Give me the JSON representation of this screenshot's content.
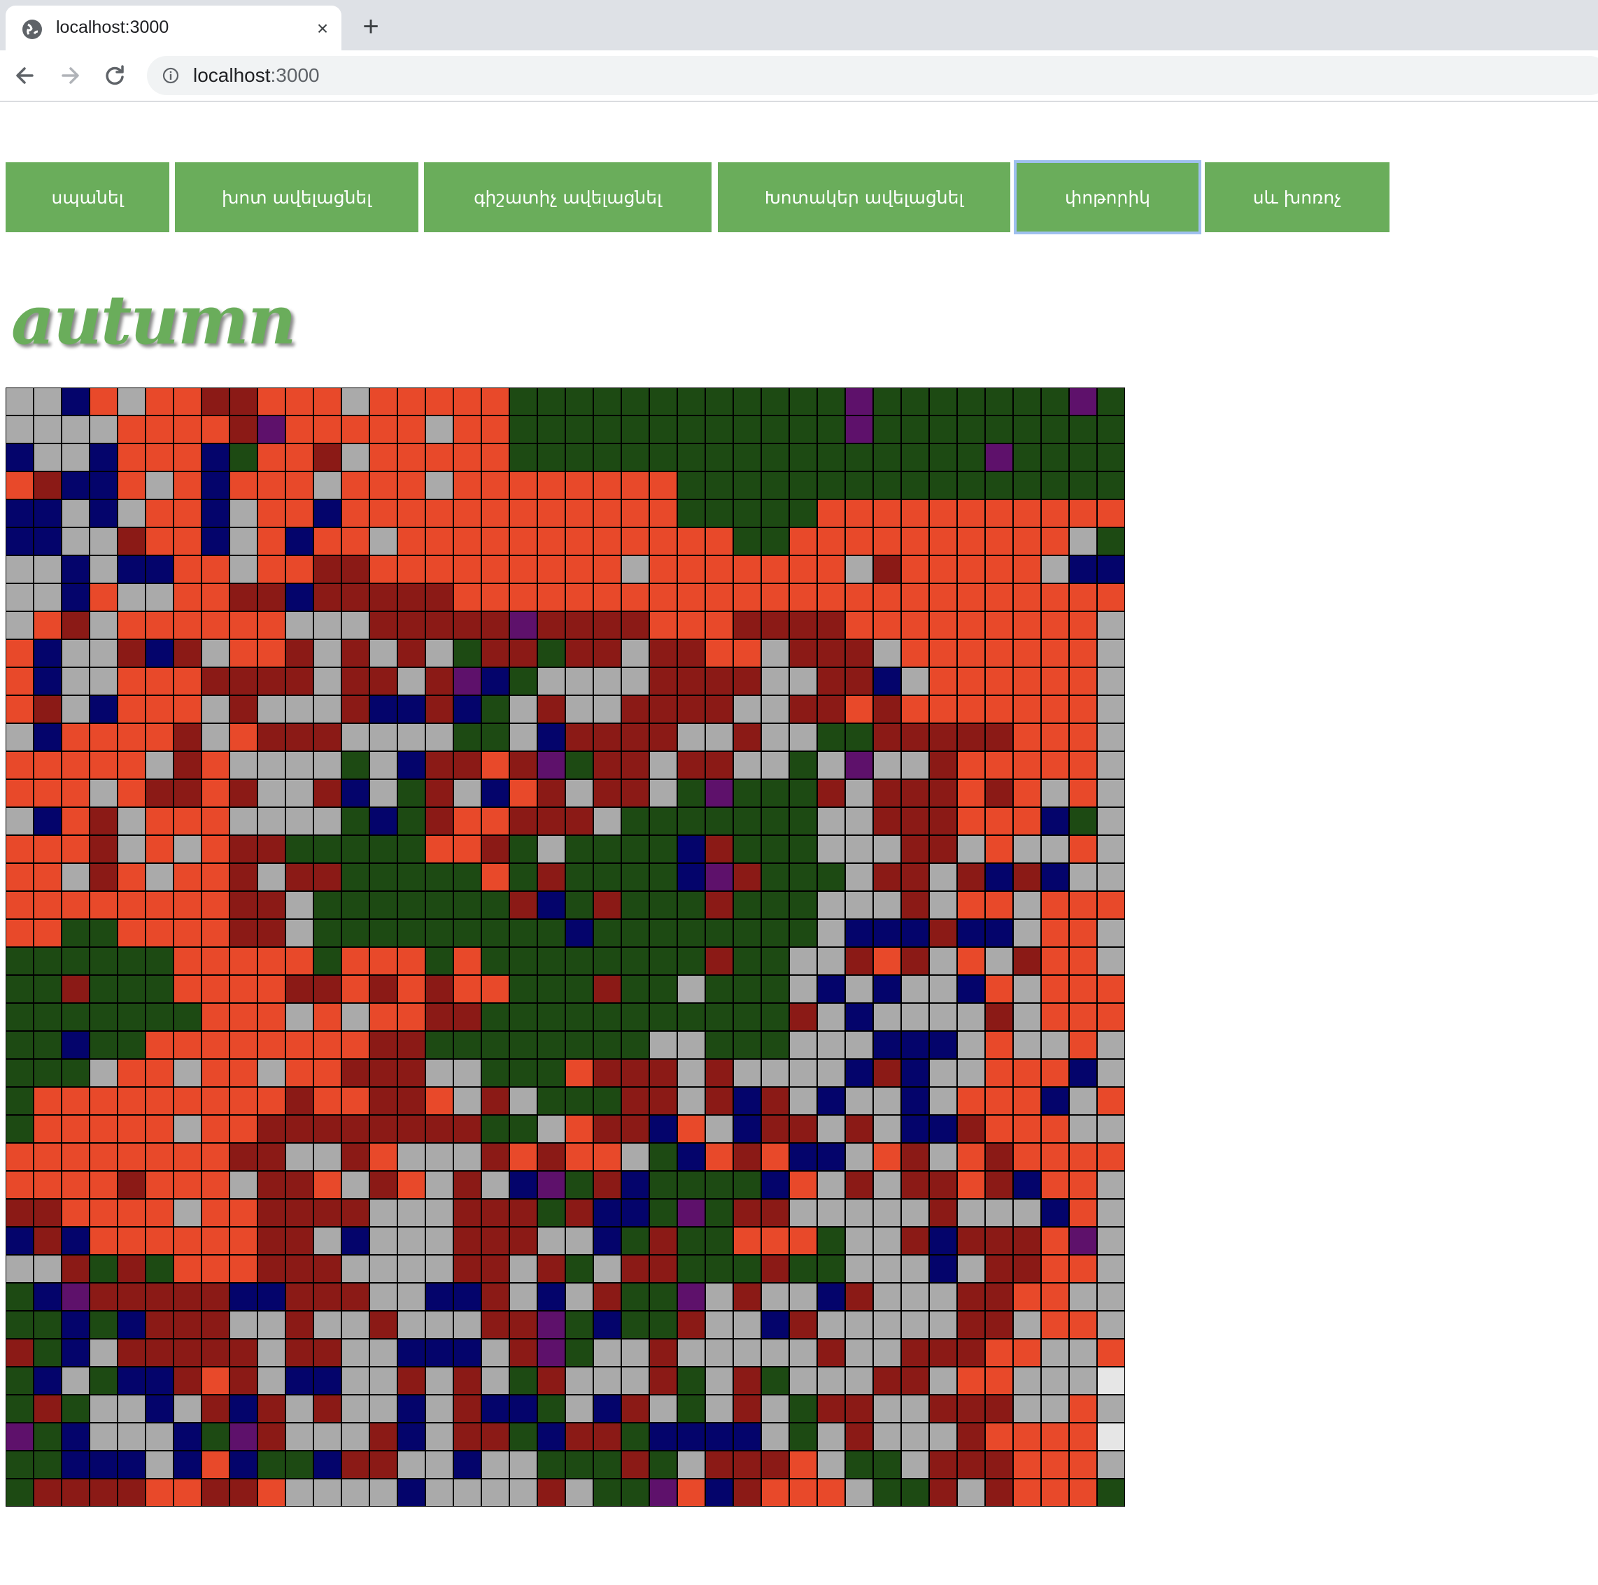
{
  "browser": {
    "tab_title": "localhost:3000",
    "close_symbol": "×",
    "new_tab_symbol": "+",
    "url_host": "localhost",
    "url_port": ":3000",
    "icons": [
      "globe-icon",
      "close-icon",
      "plus-icon",
      "back-icon",
      "forward-icon",
      "reload-icon",
      "info-icon"
    ]
  },
  "buttons": [
    {
      "label": "սպանել"
    },
    {
      "label": "խոտ ավելացնել"
    },
    {
      "label": "գիշատիչ ավելացնել"
    },
    {
      "label": "Խոտակեր ավելացնել"
    },
    {
      "label": "փոթորիկ"
    },
    {
      "label": "սև խոռոչ"
    }
  ],
  "season": "autumn",
  "colors": {
    "accent": "#6aad5b",
    "palette": {
      "O": "#e8492a",
      "R": "#8b1a16",
      "G": "#aaaaaa",
      "D": "#1d4a13",
      "N": "#04046b",
      "P": "#5e116b",
      "W": "#e6e6e6"
    }
  },
  "grid": {
    "columns": 40,
    "rows": [
      "GGNOGOORROOOGOOOOODDDDDDDDDDDDPDDDDDDDPDD",
      "GGGGOOOORPOOOOOGOODDDDDDDDDDDDPDDDDDDDDDG",
      "NGGNOOONDOORGOOOOODDDDDDDDDDDDDDDDDPDDDDG",
      "ORNNOGONOOOGOOOGOOOOOOOODDDDDDDDDDDDDDDDG",
      "NNGNGOONGOONOOOOOOOOOOOODDDDDOOOOOOOOOOOG",
      "NNGGROONGONOOGOOOOOOOOOOOODDOOOOOOOOOOGD",
      "GGNGNNOOGOORROOOOOOOOOGOOOOOOOGROOOOOGNN",
      "GGNOGGOORRNRRRRROOOOOOOOOOOOOOOOOOOOOOOO",
      "GORGOOOOOOGGGRRRRRPRRRROOORRRROOOOOOOOOG",
      "ONGGRNRGOORGRGRGDRRDRRGRROOGRRRGOOOOOOOG",
      "ONGGOOORRRRGRRGRPNDGGGGRRRRGGRRNGOOOOOOG",
      "ORGNOOOGRGGGRNNRNDGRGGRRRRGGRROROOOOOOOG",
      "GNOOOORGORRRGGGGDDGNRRRRGGRGGDDRRRRROOOG",
      "OOOOOGROGGGGDGNRRORPDRRGRRGGDGPGGROOOOOG",
      "OOOGORRORGGRNGDRGNORGRRGDPDDDRGRRROROGOG",
      "GNORGOOOGGGGDNDROORRRGDDDDDDDGGRRROOONDG",
      "OOORGOGORRDDDDDOORDGDDDDNRDDDGGGRRGOGGOG",
      "OOGROGOORGRRDDDDDODRDDDDNPRDDDGRRGRNRNGG",
      "OOOOOOOORRGDDDDDDDRNDRDDDRDDDGGGRGOOGOOO",
      "OODDOOOORRGDDDDDDDDDNDDDDDDDDGNNNRNNGOOG",
      "DDDDDDOOOOODOOODODDDDDDDDRDDGGRORGOGROOG",
      "DDRDDDOOOORROROROODDDRDDGDDDGNGNGGNOGOOO",
      "DDDDDDDOOOGOGOORRDDDDDDDDDDDRGNGGGGRGOOO",
      "DDNDDOOOOOOOORRDDDDDDDDGGDDDGGGNNNGOGGOG",
      "DDDGOOGOOGOORRRGGDDDORRRGRGGGGNRNGGOOONG",
      "DOOOOOOOOOROORROGRGDDDRRGRNRGNGGNGOOONGO",
      "DOOOOOGOORRRRRRRRDDGORRNOGNRRGRGNNROOOGG",
      "OOOOOOOORRGGROGGGROROOGDNORONNGORGOROOOO",
      "OOOOROOOGRROGROGRGNPDRNDDDDNOGRGRRORNOOG",
      "RROOOOGOORRRRGGGRRRDRNNDPDRRGGGGGRGGGNOG",
      "NRNOOOOOORRGNGGGRRRGGNDRDDOOODGGRNRRROPG",
      "GGRDRDOOORRRGGGGRRGRDGRRDDDRDDGGGNGRROOG",
      "DNPRRRRRNNRRRGGNNRGNGRDDPGRGGNRGGGRROOGG",
      "DDNDNRRRGGRGGRGGGRRPDNDDRGGNRGGGGGRRGOOG",
      "RDNGRRRRRGRRGGNNNGRPDGGRGGGGGRGGRRROOGG",
      "DNGDNNRORGNNGGRGRGDRGGGRDGRDGGGRRGOOGGGW",
      "DRDGGNGRNRGRGGNGRNNDGNRGDGRGDRRGGRRRGGOG",
      "PDNGGGNDPRGGGRNGRRDNRRDNNNNGDGRGGGROOOOW",
      "DDNNNGNONDDNRRGGNGGDDDRDGRRROGDDGRRROOOG",
      "DRRRROORROGGGGNGGGGRGDDPONROOOGDDRGROOOD"
    ]
  }
}
